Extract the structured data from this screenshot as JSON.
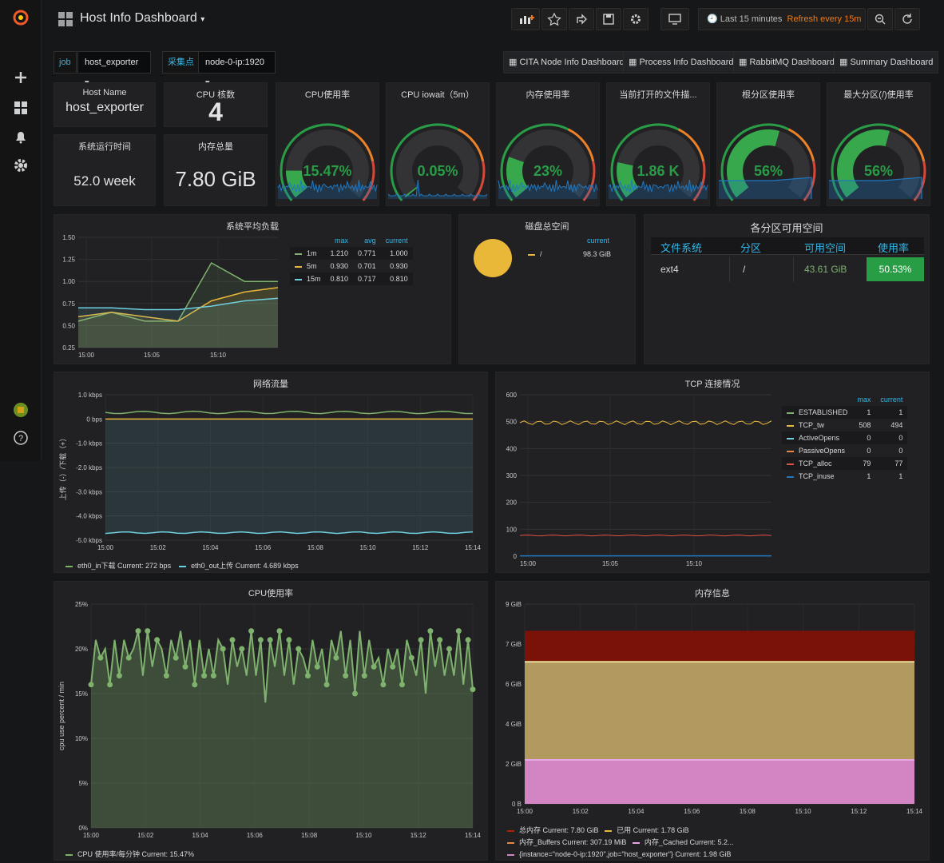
{
  "header": {
    "title": "Host Info Dashboard",
    "time_range": "Last 15 minutes",
    "refresh": "Refresh every 15m"
  },
  "variables": [
    {
      "label": "job",
      "value": "host_exporter"
    },
    {
      "label": "采集点",
      "value": "node-0-ip:1920"
    }
  ],
  "dashboard_links": [
    "CITA Node Info Dashboard",
    "Process Info Dashboard",
    "RabbitMQ Dashboard",
    "Summary Dashboard"
  ],
  "stats": {
    "host_name": {
      "title": "Host Name",
      "value": "host_exporter"
    },
    "cpu_cores": {
      "title": "CPU 核数",
      "value": "4"
    },
    "uptime": {
      "title": "系统运行时间",
      "value": "52.0 week"
    },
    "mem_total": {
      "title": "内存总量",
      "value": "7.80 GiB"
    }
  },
  "gauges": [
    {
      "title": "CPU使用率",
      "value": "15.47%",
      "fraction": 0.155
    },
    {
      "title": "CPU iowait（5m）",
      "value": "0.05%",
      "fraction": 0.005
    },
    {
      "title": "内存使用率",
      "value": "23%",
      "fraction": 0.23
    },
    {
      "title": "当前打开的文件描...",
      "value": "1.86 K",
      "fraction": 0.2
    },
    {
      "title": "根分区使用率",
      "value": "56%",
      "fraction": 0.56
    },
    {
      "title": "最大分区(/)使用率",
      "value": "56%",
      "fraction": 0.56
    }
  ],
  "load": {
    "title": "系统平均负载",
    "headers": [
      "max",
      "avg",
      "current"
    ],
    "rows": [
      {
        "name": "1m",
        "max": "1.210",
        "avg": "0.771",
        "current": "1.000",
        "color": "#7eb26d"
      },
      {
        "name": "5m",
        "max": "0.930",
        "avg": "0.701",
        "current": "0.930",
        "color": "#eab839"
      },
      {
        "name": "15m",
        "max": "0.810",
        "avg": "0.717",
        "current": "0.810",
        "color": "#6ed0e0"
      }
    ],
    "yticks": [
      "1.50",
      "1.25",
      "1.00",
      "0.75",
      "0.50",
      "0.25"
    ],
    "xticks": [
      "15:00",
      "15:05",
      "15:10"
    ]
  },
  "disk": {
    "title": "磁盘总空间",
    "header": "current",
    "name": "/",
    "value": "98.3 GiB",
    "color": "#eab839"
  },
  "partitions": {
    "title": "各分区可用空间",
    "headers": [
      "文件系统",
      "分区",
      "可用空间",
      "使用率"
    ],
    "row": [
      "ext4",
      "/",
      "43.61 GiB",
      "50.53%"
    ]
  },
  "network": {
    "title": "网络流量",
    "ylabel": "上传（-）/下载（+）",
    "yticks": [
      "1.0 kbps",
      "0 bps",
      "-1.0 kbps",
      "-2.0 kbps",
      "-3.0 kbps",
      "-4.0 kbps",
      "-5.0 kbps"
    ],
    "xticks": [
      "15:00",
      "15:02",
      "15:04",
      "15:06",
      "15:08",
      "15:10",
      "15:12",
      "15:14"
    ],
    "legend": [
      {
        "text": "eth0_in下载  Current: 272 bps",
        "color": "#7eb26d"
      },
      {
        "text": "eth0_out上传  Current: 4.689 kbps",
        "color": "#6ed0e0"
      }
    ]
  },
  "tcp": {
    "title": "TCP 连接情况",
    "yticks": [
      "600",
      "500",
      "400",
      "300",
      "200",
      "100",
      "0"
    ],
    "xticks": [
      "15:00",
      "15:05",
      "15:10"
    ],
    "headers": [
      "max",
      "current"
    ],
    "rows": [
      {
        "name": "ESTABLISHED",
        "max": "1",
        "current": "1",
        "color": "#7eb26d"
      },
      {
        "name": "TCP_tw",
        "max": "508",
        "current": "494",
        "color": "#eab839"
      },
      {
        "name": "ActiveOpens",
        "max": "0",
        "current": "0",
        "color": "#6ed0e0"
      },
      {
        "name": "PassiveOpens",
        "max": "0",
        "current": "0",
        "color": "#ef843c"
      },
      {
        "name": "TCP_alloc",
        "max": "79",
        "current": "77",
        "color": "#e24d42"
      },
      {
        "name": "TCP_inuse",
        "max": "1",
        "current": "1",
        "color": "#1f78c1"
      }
    ]
  },
  "cpu": {
    "title": "CPU使用率",
    "ylabel": "cpu use percent / min",
    "yticks": [
      "25%",
      "20%",
      "15%",
      "10%",
      "5%",
      "0%"
    ],
    "xticks": [
      "15:00",
      "15:02",
      "15:04",
      "15:06",
      "15:08",
      "15:10",
      "15:12",
      "15:14"
    ],
    "legend": "CPU 使用率/每分钟  Current: 15.47%"
  },
  "memory": {
    "title": "内存信息",
    "yticks": [
      "9 GiB",
      "7 GiB",
      "6 GiB",
      "4 GiB",
      "2 GiB",
      "0 B"
    ],
    "xticks": [
      "15:00",
      "15:02",
      "15:04",
      "15:06",
      "15:08",
      "15:10",
      "15:12",
      "15:14"
    ],
    "legend": [
      {
        "text": "总内存  Current: 7.80 GiB",
        "color": "#bf1b00"
      },
      {
        "text": "已用  Current: 1.78 GiB",
        "color": "#eab839"
      },
      {
        "text": "内存_Buffers  Current: 307.19 MiB",
        "color": "#ef843c"
      },
      {
        "text": "内存_Cached  Current: 5.2...",
        "color": "#e5a8e2"
      },
      {
        "text": "{instance=\"node-0-ip:1920\",job=\"host_exporter\"}  Current: 1.98 GiB",
        "color": "#d683ce"
      }
    ]
  },
  "chart_data": [
    {
      "type": "line",
      "title": "系统平均负载",
      "x": [
        "15:00",
        "15:05",
        "15:10"
      ],
      "ylim": [
        0.25,
        1.5
      ],
      "series": [
        {
          "name": "1m",
          "values": [
            0.55,
            0.65,
            0.55,
            0.55,
            1.21,
            1.0,
            1.0
          ]
        },
        {
          "name": "5m",
          "values": [
            0.6,
            0.65,
            0.6,
            0.55,
            0.78,
            0.88,
            0.93
          ]
        },
        {
          "name": "15m",
          "values": [
            0.7,
            0.7,
            0.68,
            0.68,
            0.72,
            0.78,
            0.81
          ]
        }
      ]
    },
    {
      "type": "line",
      "title": "网络流量",
      "ylim": [
        -5,
        1
      ],
      "series": [
        {
          "name": "eth0_in下载",
          "values": [
            0.27
          ]
        },
        {
          "name": "eth0_out上传",
          "values": [
            -4.689
          ]
        }
      ]
    },
    {
      "type": "line",
      "title": "TCP 连接情况",
      "ylim": [
        0,
        600
      ],
      "series": [
        {
          "name": "TCP_tw",
          "values": [
            494
          ]
        },
        {
          "name": "TCP_alloc",
          "values": [
            77
          ]
        },
        {
          "name": "ESTABLISHED",
          "values": [
            1
          ]
        }
      ]
    },
    {
      "type": "line",
      "title": "CPU使用率",
      "ylim": [
        0,
        25
      ],
      "series": [
        {
          "name": "CPU 使用率/每分钟",
          "values": [
            16,
            21,
            19,
            20,
            16,
            21,
            17,
            21,
            19,
            20,
            22,
            17,
            22,
            18,
            21,
            20,
            17,
            21,
            19,
            22,
            18,
            21,
            16,
            21,
            17,
            20,
            17,
            21,
            20,
            16,
            21,
            18,
            20,
            17,
            22,
            17,
            21,
            14,
            21,
            18,
            22,
            17,
            21,
            16,
            20,
            19,
            17,
            21,
            18,
            20,
            16,
            21,
            19,
            22,
            17,
            21,
            15,
            22,
            17,
            21,
            18,
            19,
            16,
            20,
            18,
            20,
            16,
            21,
            19,
            17,
            21,
            15,
            22,
            18,
            21,
            17,
            20,
            17,
            22,
            16,
            21,
            15.47
          ]
        }
      ]
    },
    {
      "type": "area",
      "title": "内存信息",
      "ylim": [
        0,
        9
      ],
      "series": [
        {
          "name": "总内存",
          "values": [
            7.8
          ]
        },
        {
          "name": "已用",
          "values": [
            1.78
          ]
        },
        {
          "name": "内存_Buffers",
          "values": [
            0.3
          ]
        },
        {
          "name": "内存_Cached",
          "values": [
            5.2
          ]
        }
      ]
    }
  ]
}
